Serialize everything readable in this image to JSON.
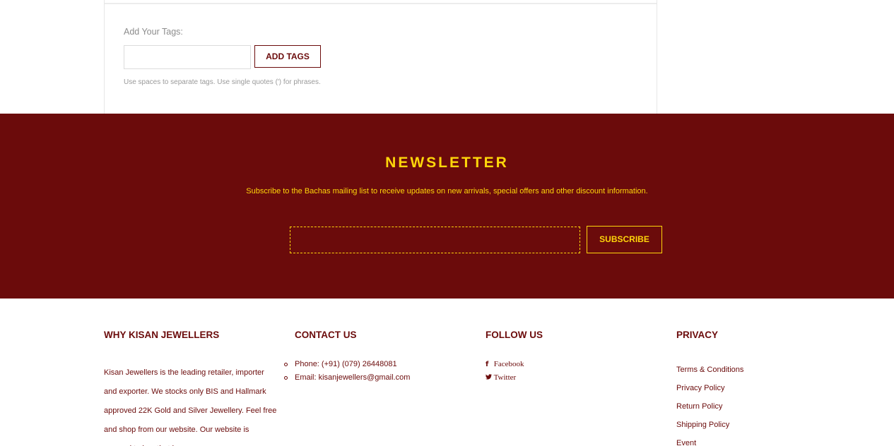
{
  "tags": {
    "label": "Add Your Tags:",
    "input_value": "",
    "button_label": "ADD TAGS",
    "help_text": "Use spaces to separate tags. Use single quotes (') for phrases."
  },
  "newsletter": {
    "title": "NEWSLETTER",
    "subtitle": "Subscribe to the Bachas mailing list to receive updates on new arrivals, special offers and other discount information.",
    "input_value": "",
    "button_label": "SUBSCRIBE"
  },
  "footer": {
    "why": {
      "title": "WHY KISAN JEWELLERS",
      "text": "Kisan Jewellers is the leading retailer, importer and exporter. We stocks only BIS and Hallmark approved 22K Gold and Silver Jewellery. Feel free and shop from our website. Our website is secured to buy that is"
    },
    "contact": {
      "title": "CONTACT US",
      "items": [
        "Phone: (+91) (079) 26448081",
        "Email: kisanjewellers@gmail.com"
      ]
    },
    "follow": {
      "title": "FOLLOW US",
      "items": [
        {
          "icon": "facebook-icon",
          "glyph": "f",
          "label": "Facebook"
        },
        {
          "icon": "twitter-icon",
          "glyph": "🐦",
          "label": "Twitter"
        }
      ]
    },
    "privacy": {
      "title": "PRIVACY",
      "items": [
        "Terms & Conditions",
        "Privacy Policy",
        "Return Policy",
        "Shipping Policy",
        "Event"
      ]
    }
  },
  "colors": {
    "brand": "#6b0b0b",
    "accent": "#ffd60a"
  }
}
